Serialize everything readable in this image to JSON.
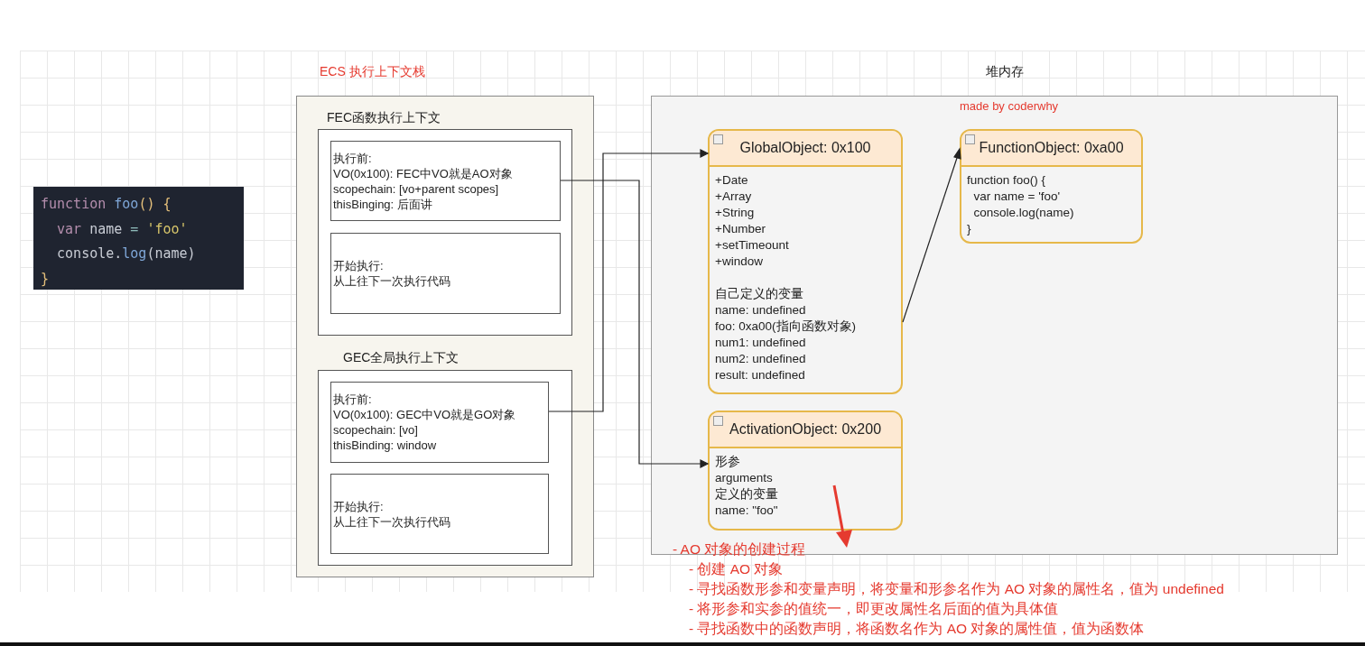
{
  "code_snippet": {
    "lines": [
      [
        {
          "text": "function",
          "kind": "keyword"
        },
        {
          "text": " foo",
          "kind": "name"
        },
        {
          "text": "() {",
          "kind": "punct"
        }
      ],
      [
        {
          "text": "  var",
          "kind": "keyword"
        },
        {
          "text": " name ",
          "kind": "plain"
        },
        {
          "text": "=",
          "kind": "operator"
        },
        {
          "text": " 'foo'",
          "kind": "string"
        }
      ],
      [
        {
          "text": "  console.",
          "kind": "plain"
        },
        {
          "text": "log",
          "kind": "name"
        },
        {
          "text": "(name)",
          "kind": "plain"
        }
      ],
      [
        {
          "text": "}",
          "kind": "punct"
        }
      ]
    ]
  },
  "ecs_stack": {
    "title": "ECS 执行上下文栈",
    "contexts": [
      {
        "title": "FEC函数执行上下文",
        "before": [
          "执行前:",
          "VO(0x100): FEC中VO就是AO对象",
          "scopechain: [vo+parent scopes]",
          "thisBinging: 后面讲"
        ],
        "during": [
          "开始执行:",
          "从上往下一次执行代码"
        ]
      },
      {
        "title": "GEC全局执行上下文",
        "before": [
          "执行前:",
          "VO(0x100): GEC中VO就是GO对象",
          "scopechain: [vo]",
          "thisBinding: window"
        ],
        "during": [
          "开始执行:",
          "从上往下一次执行代码"
        ]
      }
    ]
  },
  "heap": {
    "title": "堆内存",
    "credit": "made by coderwhy",
    "objects": [
      {
        "title": "GlobalObject: 0x100",
        "sections": [
          [
            "+Date",
            "+Array",
            "+String",
            "+Number",
            "+setTimeount",
            "+window"
          ],
          [
            "自己定义的变量",
            "name: undefined",
            "foo: 0xa00(指向函数对象)",
            "num1: undefined",
            "num2: undefined",
            "result: undefined"
          ]
        ]
      },
      {
        "title": "FunctionObject: 0xa00",
        "sections": [
          [
            "function foo() {",
            "  var name = 'foo'",
            "  console.log(name)",
            "}"
          ]
        ]
      },
      {
        "title": "ActivationObject: 0x200",
        "sections": [
          [
            "形参",
            "arguments",
            "定义的变量",
            "name: \"foo\""
          ]
        ]
      }
    ]
  },
  "notes": [
    {
      "text": "- AO 对象的创建过程",
      "children": [
        {
          "text": "- 创建 AO 对象"
        },
        {
          "text": "- 寻找函数形参和变量声明，将变量和形参名作为 AO 对象的属性名，值为 undefined"
        },
        {
          "text": "- 将形参和实参的值统一，即更改属性名后面的值为具体值"
        },
        {
          "text": "- 寻找函数中的函数声明，将函数名作为 AO 对象的属性值，值为函数体"
        }
      ]
    }
  ]
}
